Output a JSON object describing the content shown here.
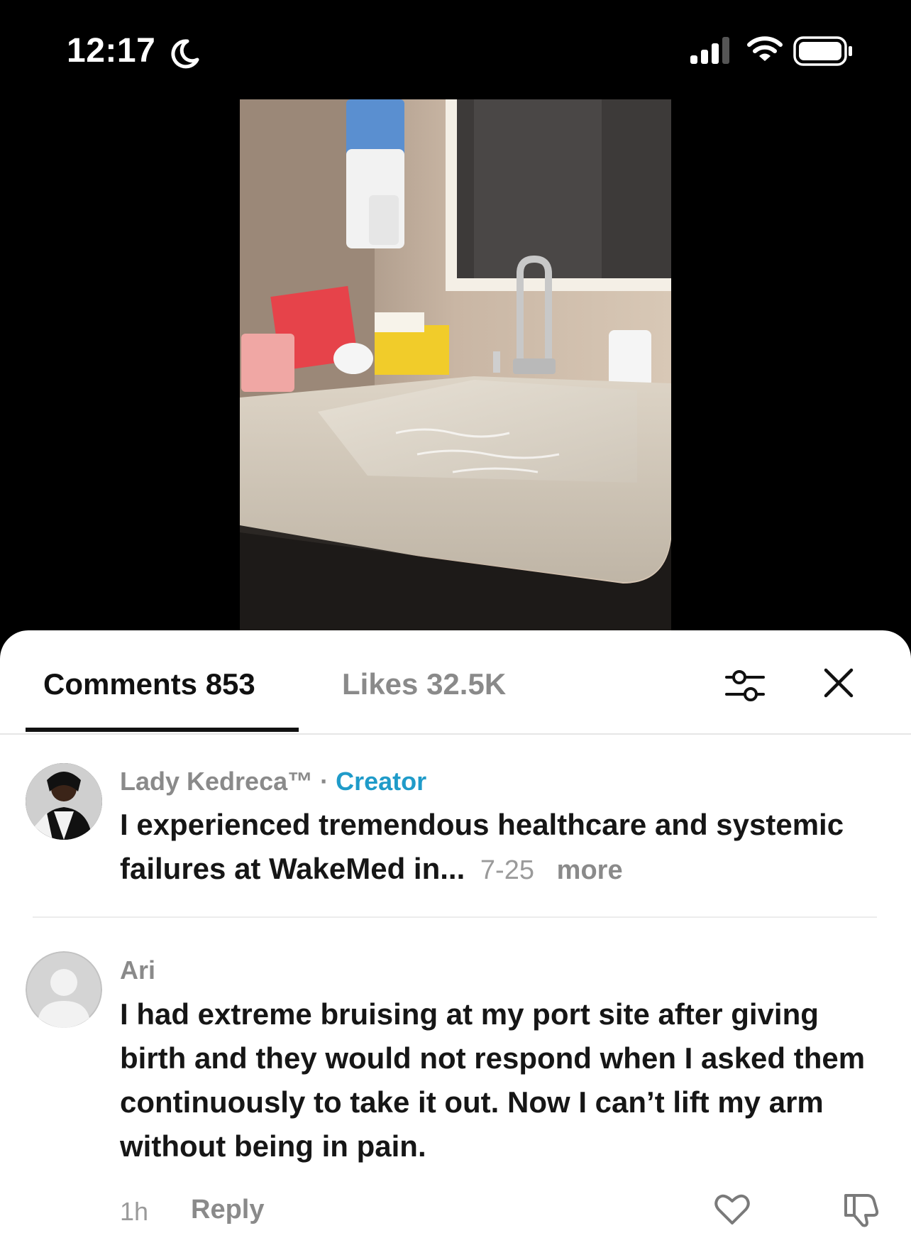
{
  "status_bar": {
    "time": "12:17",
    "icons": [
      "moon-icon",
      "cellular-signal-icon",
      "wifi-icon",
      "battery-icon"
    ]
  },
  "video": {
    "description_icon": "video-frame"
  },
  "tabs": {
    "comments_label": "Comments 853",
    "likes_label": "Likes 32.5K",
    "active": "comments"
  },
  "comments": [
    {
      "username": "Lady Kedreca™",
      "separator": " · ",
      "badge": "Creator",
      "text": "I experienced tremendous healthcare and systemic failures at WakeMed in...",
      "date": "7-25",
      "more_label": "more"
    },
    {
      "username": "Ari",
      "text": "I had extreme bruising at my port site after giving birth and they would not respond when I asked them continuously to take it out. Now I can’t lift my arm without being in pain.",
      "time": "1h",
      "reply_label": "Reply"
    }
  ],
  "colors": {
    "accent_creator": "#1f9bc9",
    "muted": "#8a8a8a",
    "text": "#161616"
  }
}
